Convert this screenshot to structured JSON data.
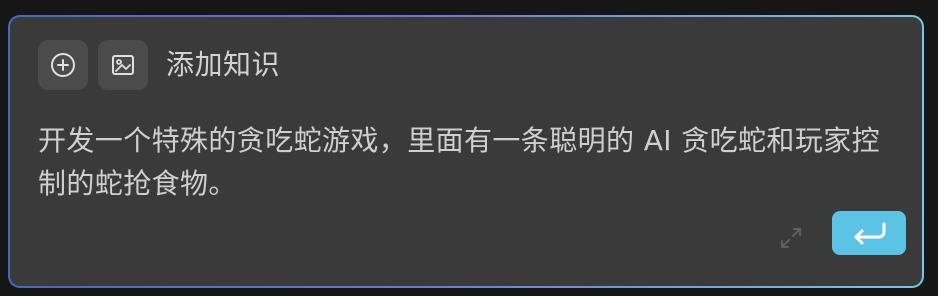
{
  "composer": {
    "tools": [
      {
        "name": "add",
        "icon": "plus-circle-icon"
      },
      {
        "name": "image",
        "icon": "image-icon"
      }
    ],
    "knowledge_label": "添加知识",
    "prompt_text": "开发一个特殊的贪吃蛇游戏，里面有一条聪明的 AI 贪吃蛇和玩家控制的蛇抢食物。",
    "expand_icon": "expand-icon",
    "send_icon": "return-arrow-icon"
  },
  "colors": {
    "page_background": "#161616",
    "panel_background": "#3a3a3a",
    "tool_button_background": "#4b4b4b",
    "text": "#cfcfcf",
    "send_button": "#5cc3e5",
    "border_gradient_start": "#4a67b8",
    "border_gradient_end": "#79c6e6"
  }
}
